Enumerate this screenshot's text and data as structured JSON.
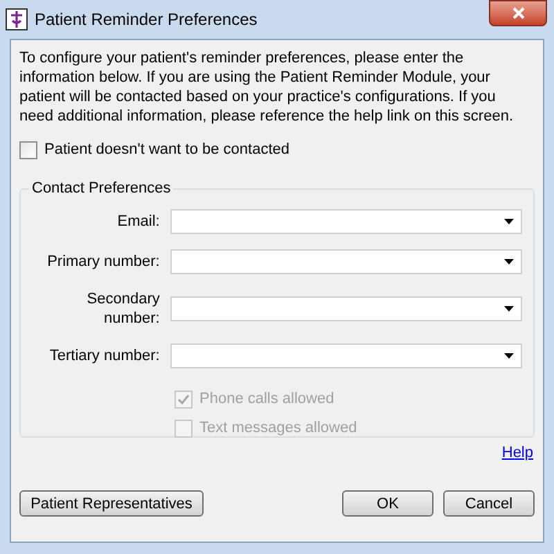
{
  "window": {
    "title": "Patient Reminder Preferences"
  },
  "intro": "To configure your patient's reminder preferences, please enter the information below. If you are using the Patient Reminder Module, your patient will be contacted based on your practice's configurations. If you need additional information, please reference the help link on this screen.",
  "opt_out": {
    "label": "Patient doesn't want to be contacted",
    "checked": false,
    "disabled": false
  },
  "contact_preferences": {
    "title": "Contact Preferences",
    "fields": [
      {
        "label": "Email:"
      },
      {
        "label": "Primary number:"
      },
      {
        "label": "Secondary number:"
      },
      {
        "label": "Tertiary number:"
      }
    ],
    "options": [
      {
        "label": "Phone calls allowed",
        "checked": true,
        "disabled": true
      },
      {
        "label": "Text messages allowed",
        "checked": false,
        "disabled": true
      }
    ]
  },
  "help_link": "Help",
  "buttons": {
    "left": "Patient Representatives",
    "ok": "OK",
    "cancel": "Cancel"
  }
}
